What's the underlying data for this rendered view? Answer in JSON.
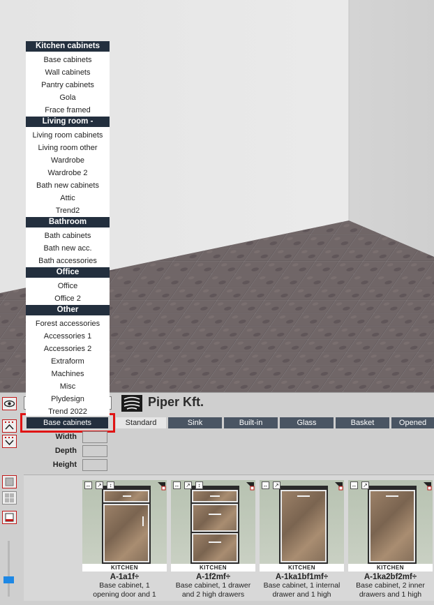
{
  "menu": {
    "sections": [
      {
        "header": "Kitchen cabinets",
        "items": [
          "Base cabinets",
          "Wall cabinets",
          "Pantry cabinets",
          "Gola",
          "Frace framed"
        ]
      },
      {
        "header": "Living room -",
        "items": [
          "Living room cabinets",
          "Living room other",
          "Wardrobe",
          "Wardrobe 2",
          "Bath new cabinets",
          "Attic",
          "Trend2"
        ]
      },
      {
        "header": "Bathroom",
        "items": [
          "Bath cabinets",
          "Bath new acc.",
          "Bath accessories"
        ]
      },
      {
        "header": "Office",
        "items": [
          "Office",
          "Office 2"
        ]
      },
      {
        "header": "Other",
        "items": [
          "Forest accessories",
          "Accessories 1",
          "Accessories 2",
          "Extraform",
          "Machines",
          "Misc",
          "Plydesign",
          "Trend 2022"
        ]
      }
    ]
  },
  "header": {
    "company": "Piper Kft.",
    "selected_category": "Base cabinets"
  },
  "tabs": [
    "Standard",
    "Sink",
    "Built-in",
    "Glass",
    "Basket",
    "Opened"
  ],
  "active_tab": "Standard",
  "dimensions": {
    "width_label": "Width",
    "depth_label": "Depth",
    "height_label": "Height"
  },
  "products": [
    {
      "code": "A-1a1f÷",
      "brand": "KITCHEN",
      "desc": "Base cabinet, 1\nopening door and 1"
    },
    {
      "code": "A-1f2mf÷",
      "brand": "KITCHEN",
      "desc": "Base cabinet, 1 drawer\nand 2 high drawers"
    },
    {
      "code": "A-1ka1bf1mf÷",
      "brand": "KITCHEN",
      "desc": "Base cabinet, 1 internal\ndrawer and 1 high"
    },
    {
      "code": "A-1ka2bf2mf÷",
      "brand": "KITCHEN",
      "desc": "Base cabinet, 2 inner\ndrawers and 1 high"
    }
  ],
  "icons": {
    "eye": "eye-icon",
    "arrow_up": "arrow-up-icon",
    "arrow_down": "arrow-down-icon",
    "single_view": "single-view-icon",
    "grid_view": "grid-view-icon",
    "color_swatch": "color-swatch-icon",
    "resize": "resize-icon",
    "expand": "expand-icon",
    "height": "height-icon",
    "corner": "corner-icon",
    "logo": "piper-logo-icon"
  },
  "colors": {
    "accent_red": "#e01414",
    "dark_navy": "#232f3e",
    "tab_gray": "#4a5563",
    "slider_blue": "#1e88e5"
  }
}
